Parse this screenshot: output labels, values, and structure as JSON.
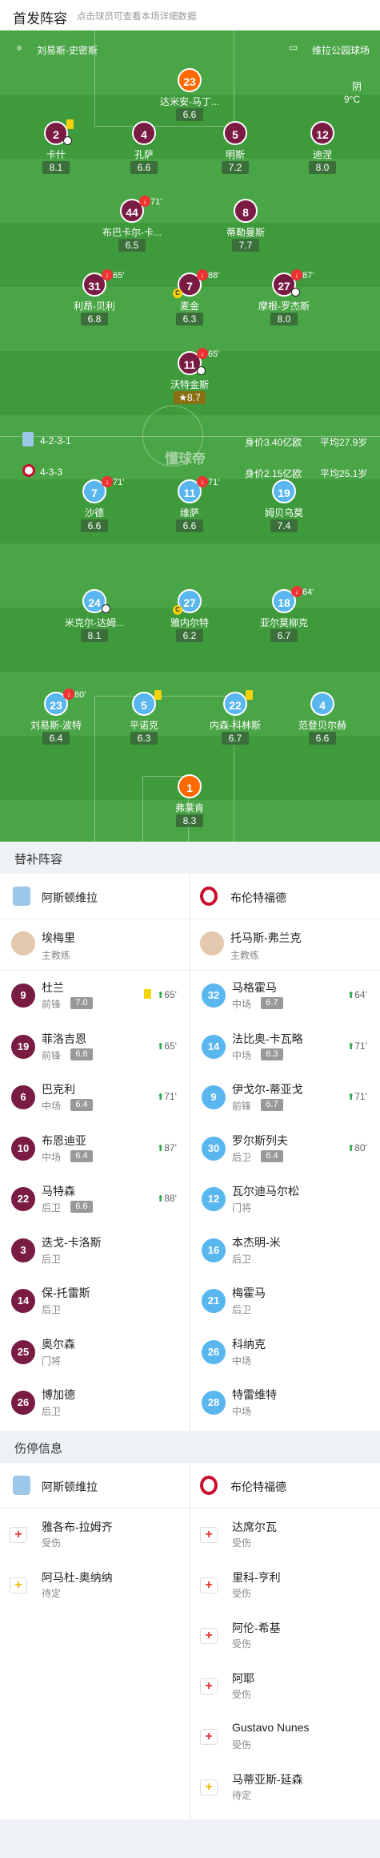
{
  "header": {
    "title": "首发阵容",
    "subtitle": "点击球员可查看本场详细数据"
  },
  "venue": {
    "coach_left": "刘易斯-史密斯",
    "stadium": "维拉公园球场",
    "weather": "阴",
    "temp": "9°C"
  },
  "watermark": "懂球帝",
  "home_team_info": {
    "formation": "4-2-3-1",
    "value": "身价3.40亿欧",
    "age": "平均27.9岁"
  },
  "away_team_info": {
    "formation": "4-3-3",
    "value": "身价2.15亿欧",
    "age": "平均25.1岁"
  },
  "home_players": [
    {
      "num": "23",
      "name": "达米安-马丁...",
      "rating": "6.6",
      "gk": true
    },
    {
      "num": "2",
      "name": "卡什",
      "rating": "8.1",
      "ycard": true,
      "ball": true
    },
    {
      "num": "4",
      "name": "孔萨",
      "rating": "6.6"
    },
    {
      "num": "5",
      "name": "明斯",
      "rating": "7.2"
    },
    {
      "num": "12",
      "name": "迪涅",
      "rating": "8.0"
    },
    {
      "num": "44",
      "name": "布巴卡尔-卡...",
      "rating": "6.5",
      "sub": "71'"
    },
    {
      "num": "8",
      "name": "蒂勒曼斯",
      "rating": "7.7"
    },
    {
      "num": "31",
      "name": "利昂-贝利",
      "rating": "6.8",
      "sub": "65'"
    },
    {
      "num": "7",
      "name": "麦金",
      "rating": "6.3",
      "sub": "88'",
      "cap": true
    },
    {
      "num": "27",
      "name": "摩根-罗杰斯",
      "rating": "8.0",
      "sub": "87'",
      "ball": true
    },
    {
      "num": "11",
      "name": "沃特金斯",
      "rating": "8.7",
      "sub": "65'",
      "ball": true,
      "star": true
    }
  ],
  "away_players": [
    {
      "num": "7",
      "name": "沙德",
      "rating": "6.6",
      "sub": "71'"
    },
    {
      "num": "11",
      "name": "维萨",
      "rating": "6.6",
      "sub": "71'"
    },
    {
      "num": "19",
      "name": "姆贝乌莫",
      "rating": "7.4"
    },
    {
      "num": "24",
      "name": "米克尔-达姆...",
      "rating": "8.1",
      "ball": true
    },
    {
      "num": "27",
      "name": "雅内尔特",
      "rating": "6.2",
      "cap": true
    },
    {
      "num": "18",
      "name": "亚尔莫柳克",
      "rating": "6.7",
      "sub": "64'"
    },
    {
      "num": "23",
      "name": "刘易斯-波特",
      "rating": "6.4",
      "sub": "80'"
    },
    {
      "num": "5",
      "name": "平诺克",
      "rating": "6.3",
      "ycard": true
    },
    {
      "num": "22",
      "name": "内森-科林斯",
      "rating": "6.7",
      "ycard": true
    },
    {
      "num": "4",
      "name": "范登贝尔赫",
      "rating": "6.6"
    },
    {
      "num": "1",
      "name": "弗莱肯",
      "rating": "8.3",
      "gk": true
    }
  ],
  "subs_title": "替补阵容",
  "teams": {
    "home": "阿斯顿维拉",
    "away": "布伦特福德"
  },
  "coaches": {
    "home_name": "埃梅里",
    "away_name": "托马斯-弗兰克",
    "role": "主教练"
  },
  "home_subs": [
    {
      "num": "9",
      "name": "杜兰",
      "pos": "前锋",
      "rating": "7.0",
      "minute": "65'",
      "ycard": true
    },
    {
      "num": "19",
      "name": "菲洛吉恩",
      "pos": "前锋",
      "rating": "6.6",
      "minute": "65'"
    },
    {
      "num": "6",
      "name": "巴克利",
      "pos": "中场",
      "rating": "6.4",
      "minute": "71'"
    },
    {
      "num": "10",
      "name": "布恩迪亚",
      "pos": "中场",
      "rating": "6.4",
      "minute": "87'"
    },
    {
      "num": "22",
      "name": "马特森",
      "pos": "后卫",
      "rating": "6.6",
      "minute": "88'"
    },
    {
      "num": "3",
      "name": "迭戈-卡洛斯",
      "pos": "后卫"
    },
    {
      "num": "14",
      "name": "保-托雷斯",
      "pos": "后卫"
    },
    {
      "num": "25",
      "name": "奥尔森",
      "pos": "门将"
    },
    {
      "num": "26",
      "name": "博加德",
      "pos": "后卫"
    }
  ],
  "away_subs": [
    {
      "num": "32",
      "name": "马格霍马",
      "pos": "中场",
      "rating": "6.7",
      "minute": "64'"
    },
    {
      "num": "14",
      "name": "法比奥-卡瓦略",
      "pos": "中场",
      "rating": "6.3",
      "minute": "71'"
    },
    {
      "num": "9",
      "name": "伊戈尔-蒂亚戈",
      "pos": "前锋",
      "rating": "6.7",
      "minute": "71'"
    },
    {
      "num": "30",
      "name": "罗尔斯列夫",
      "pos": "后卫",
      "rating": "6.4",
      "minute": "80'"
    },
    {
      "num": "12",
      "name": "瓦尔迪马尔松",
      "pos": "门将"
    },
    {
      "num": "16",
      "name": "本杰明-米",
      "pos": "后卫"
    },
    {
      "num": "21",
      "name": "梅霍马",
      "pos": "后卫"
    },
    {
      "num": "26",
      "name": "科纳克",
      "pos": "中场"
    },
    {
      "num": "28",
      "name": "特雷维特",
      "pos": "中场"
    }
  ],
  "injury_title": "伤停信息",
  "home_injuries": [
    {
      "name": "雅各布-拉姆齐",
      "status": "受伤",
      "pending": false
    },
    {
      "name": "阿马杜-奥纳纳",
      "status": "待定",
      "pending": true
    }
  ],
  "away_injuries": [
    {
      "name": "达席尔瓦",
      "status": "受伤",
      "pending": false
    },
    {
      "name": "里科-亨利",
      "status": "受伤",
      "pending": false
    },
    {
      "name": "阿伦-希基",
      "status": "受伤",
      "pending": false
    },
    {
      "name": "阿耶",
      "status": "受伤",
      "pending": false
    },
    {
      "name": "Gustavo Nunes",
      "status": "受伤",
      "pending": false
    },
    {
      "name": "马蒂亚斯-延森",
      "status": "待定",
      "pending": true
    }
  ],
  "colors": {
    "pitch": "#3f9a3b",
    "home": "#7a1b43",
    "away": "#5ab6ef",
    "gk": "#ff6a00",
    "sub_arrow": "#2fa84f",
    "card": "#f6d20b"
  }
}
